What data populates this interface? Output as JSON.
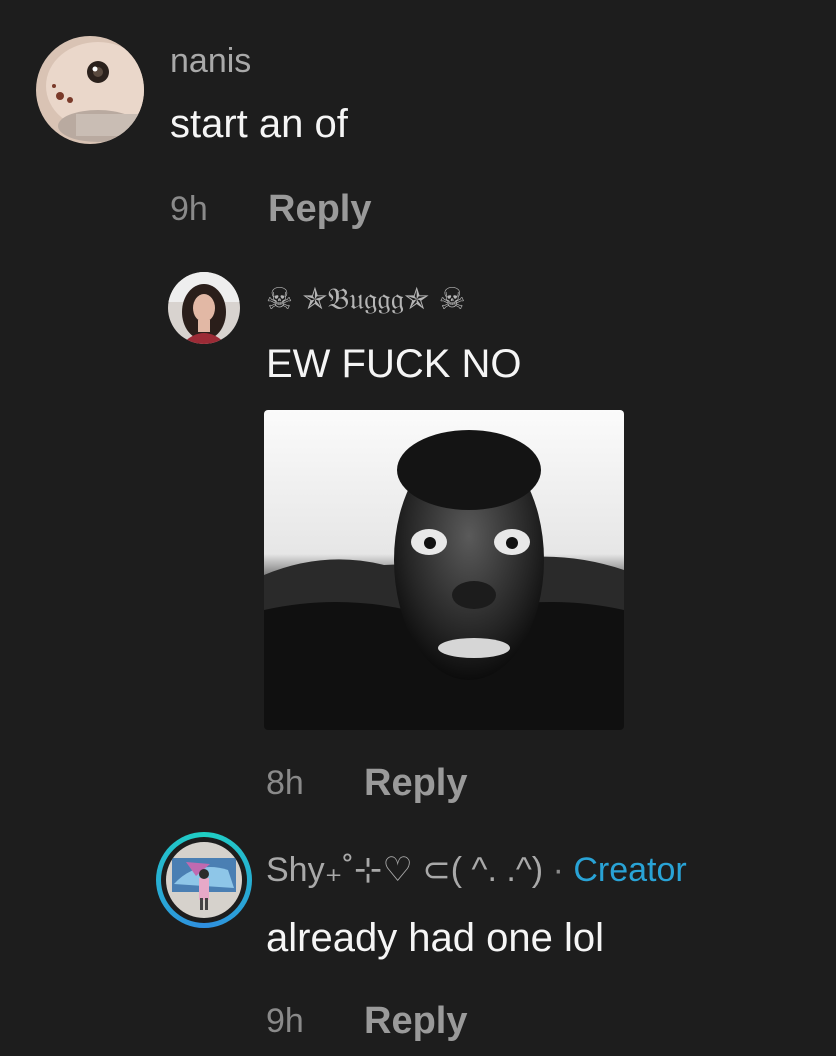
{
  "comments": [
    {
      "username": "nanis",
      "text": "start an of",
      "time": "9h",
      "reply_label": "Reply"
    },
    {
      "username": "☠ ✯𝔅𝔲𝔤𝔤𝔤✯ ☠",
      "text": "EW FUCK NO",
      "time": "8h",
      "reply_label": "Reply"
    },
    {
      "username": "Shy₊˚⊹♡ ⊂( ^. .^)",
      "separator": "·",
      "badge": "Creator",
      "text": "already had one lol",
      "time": "9h",
      "reply_label": "Reply"
    }
  ],
  "colors": {
    "background": "#1d1d1d",
    "creator_badge": "#29a3d6"
  }
}
